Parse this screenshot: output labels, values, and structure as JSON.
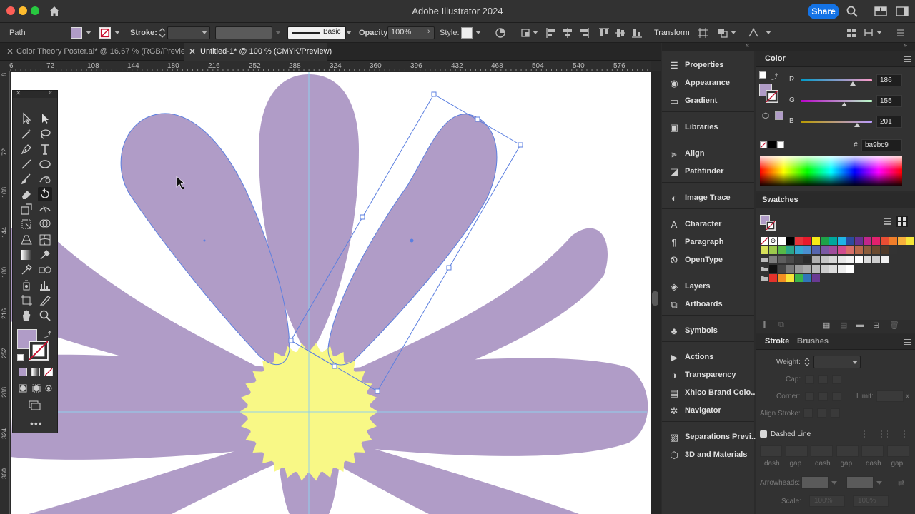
{
  "window": {
    "title": "Adobe Illustrator 2024",
    "share_label": "Share"
  },
  "control_bar": {
    "selection": "Path",
    "fill_color": "#b09cc7",
    "stroke_label": "Stroke:",
    "brush_profile": "Basic",
    "opacity_label": "Opacity:",
    "opacity_value": "100%",
    "style_label": "Style:",
    "transform_label": "Transform"
  },
  "tabs": [
    {
      "label": "Color Theory Poster.ai* @ 16.67 % (RGB/Preview)",
      "active": false
    },
    {
      "label": "Untitled-1* @ 100 % (CMYK/Preview)",
      "active": true
    }
  ],
  "ruler": {
    "top_ticks": [
      "6",
      "72",
      "108",
      "144",
      "180",
      "216",
      "252",
      "288",
      "324",
      "360",
      "396",
      "432",
      "468",
      "504",
      "540",
      "576"
    ],
    "left_ticks": [
      "8",
      "72",
      "108",
      "144",
      "180",
      "216",
      "252",
      "288",
      "324",
      "360"
    ]
  },
  "artwork": {
    "petal_color": "#b09cc7",
    "center_color": "#f8f886",
    "guide_color": "#8fd0ee",
    "selection_color": "#5b7fe0"
  },
  "icon_panel": {
    "groups": [
      [
        "Properties",
        "Appearance",
        "Gradient"
      ],
      [
        "Libraries"
      ],
      [
        "Align",
        "Pathfinder"
      ],
      [
        "Image Trace"
      ],
      [
        "Character",
        "Paragraph",
        "OpenType"
      ],
      [
        "Layers",
        "Artboards"
      ],
      [
        "Symbols"
      ],
      [
        "Actions",
        "Transparency",
        "Xhico Brand Colo...",
        "Navigator"
      ],
      [
        "Separations Previ...",
        "3D and Materials"
      ]
    ]
  },
  "color_panel": {
    "title": "Color",
    "r_label": "R",
    "r_value": "186",
    "g_label": "G",
    "g_value": "155",
    "b_label": "B",
    "b_value": "201",
    "hash": "#",
    "hex": "ba9bc9",
    "current": "#ba9bc9"
  },
  "swatches_panel": {
    "title": "Swatches",
    "row1": [
      "#ffffff",
      "#000000",
      "#e6343a",
      "#e8192c",
      "#f6eb16",
      "#1da348",
      "#00a89d",
      "#1fb5e6",
      "#2b4b9e",
      "#673291",
      "#c2268a",
      "#e2216d",
      "#e94e34",
      "#f07e2a",
      "#f8af3c",
      "#f6e63a"
    ],
    "row2": [
      "#d8e05a",
      "#9cc94c",
      "#57b948",
      "#2aa58b",
      "#35a6cf",
      "#4a8fd0",
      "#5565ae",
      "#7a59a4",
      "#a14d9c",
      "#d14c8e",
      "#d86f69",
      "#b7694a",
      "#8c5d3c",
      "#6b4a2f",
      "#4f3a29",
      "#333333"
    ],
    "row3": [
      "#7e7e7e",
      "#5e5e5e",
      "#4a4a4a",
      "#383838",
      "#2b2b2b",
      "#b0b0b0",
      "#c6c6c6",
      "#d8d8d8",
      "#e8e8e8",
      "#f4f4f4",
      "#ffffff",
      "#dddddd",
      "#cfcfcf",
      "#f0f0f0"
    ],
    "row4": [
      "#111111",
      "#444444",
      "#777777",
      "#999999",
      "#aaaaaa",
      "#bbbbbb",
      "#cccccc",
      "#dddddd",
      "#eeeeee",
      "#ffffff"
    ],
    "row5": [
      "#e3322b",
      "#f28f22",
      "#f7e538",
      "#3ab54a",
      "#2f75ba",
      "#6a3a93"
    ]
  },
  "stroke_panel": {
    "tab_stroke": "Stroke",
    "tab_brushes": "Brushes",
    "weight_label": "Weight:",
    "cap_label": "Cap:",
    "corner_label": "Corner:",
    "limit_label": "Limit:",
    "limit_x": "x",
    "align_label": "Align Stroke:",
    "dashed_label": "Dashed Line",
    "dash_labels": [
      "dash",
      "gap",
      "dash",
      "gap",
      "dash",
      "gap"
    ],
    "arrowheads_label": "Arrowheads:",
    "scale_label": "Scale:",
    "scale_value": "100%"
  }
}
